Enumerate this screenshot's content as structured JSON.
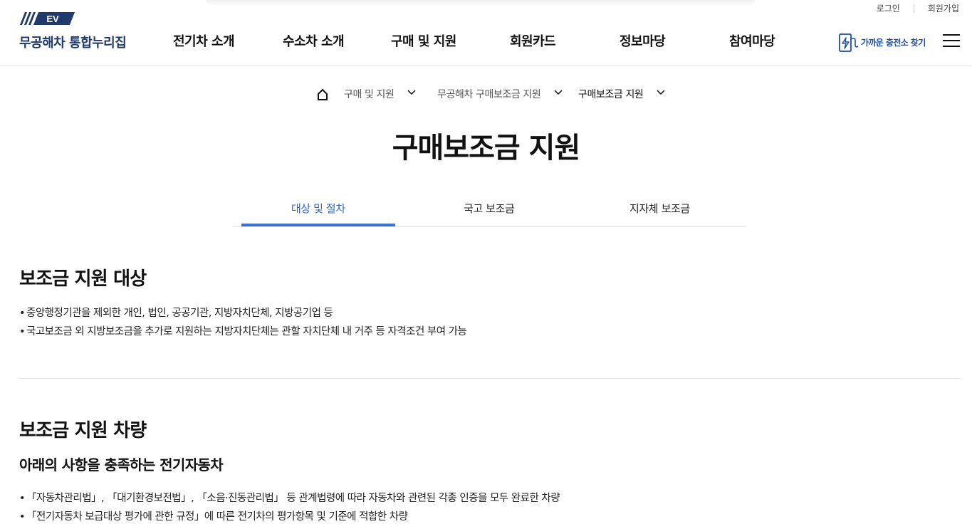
{
  "header": {
    "logo_mark": "EV",
    "logo_text": "무공해차 통합누리집",
    "util": {
      "login": "로그인",
      "signup": "회원가입"
    },
    "nav": [
      "전기차 소개",
      "수소차 소개",
      "구매 및 지원",
      "회원카드",
      "정보마당",
      "참여마당"
    ],
    "charger_label": "가까운 충전소 찾기",
    "icons": [
      "charger-icon",
      "menu-icon"
    ]
  },
  "breadcrumb": {
    "home_icon": "home-icon",
    "items": [
      "구매 및 지원",
      "무공해차 구매보조금 지원",
      "구매보조금 지원"
    ]
  },
  "page_title": "구매보조금 지원",
  "tabs": {
    "items": [
      "대상 및 절차",
      "국고 보조금",
      "지자체 보조금"
    ],
    "active": "대상 및 절차",
    "accent_color": "#3b6fd0"
  },
  "sections": {
    "target": {
      "title": "보조금 지원 대상",
      "bullets": [
        "중앙행정기관을 제외한 개인, 법인, 공공기관, 지방자치단체, 지방공기업 등",
        "국고보조금 외 지방보조금을 추가로 지원하는 지방자치단체는 관할 자치단체 내 거주 등 자격조건 부여 가능"
      ]
    },
    "vehicle": {
      "title": "보조금 지원 차량",
      "subtitle": "아래의 사항을 충족하는 전기자동차",
      "bullets": [
        "「자동차관리법」, 「대기환경보전법」, 「소음·진동관리법」 등 관계법령에 따라 자동차와 관련된 각종 인증을 모두 완료한 차량",
        "「전기자동차 보급대상 평가에 관한 규정」에 따른 전기차의 평가항목 및 기준에 적합한 차량"
      ]
    }
  }
}
